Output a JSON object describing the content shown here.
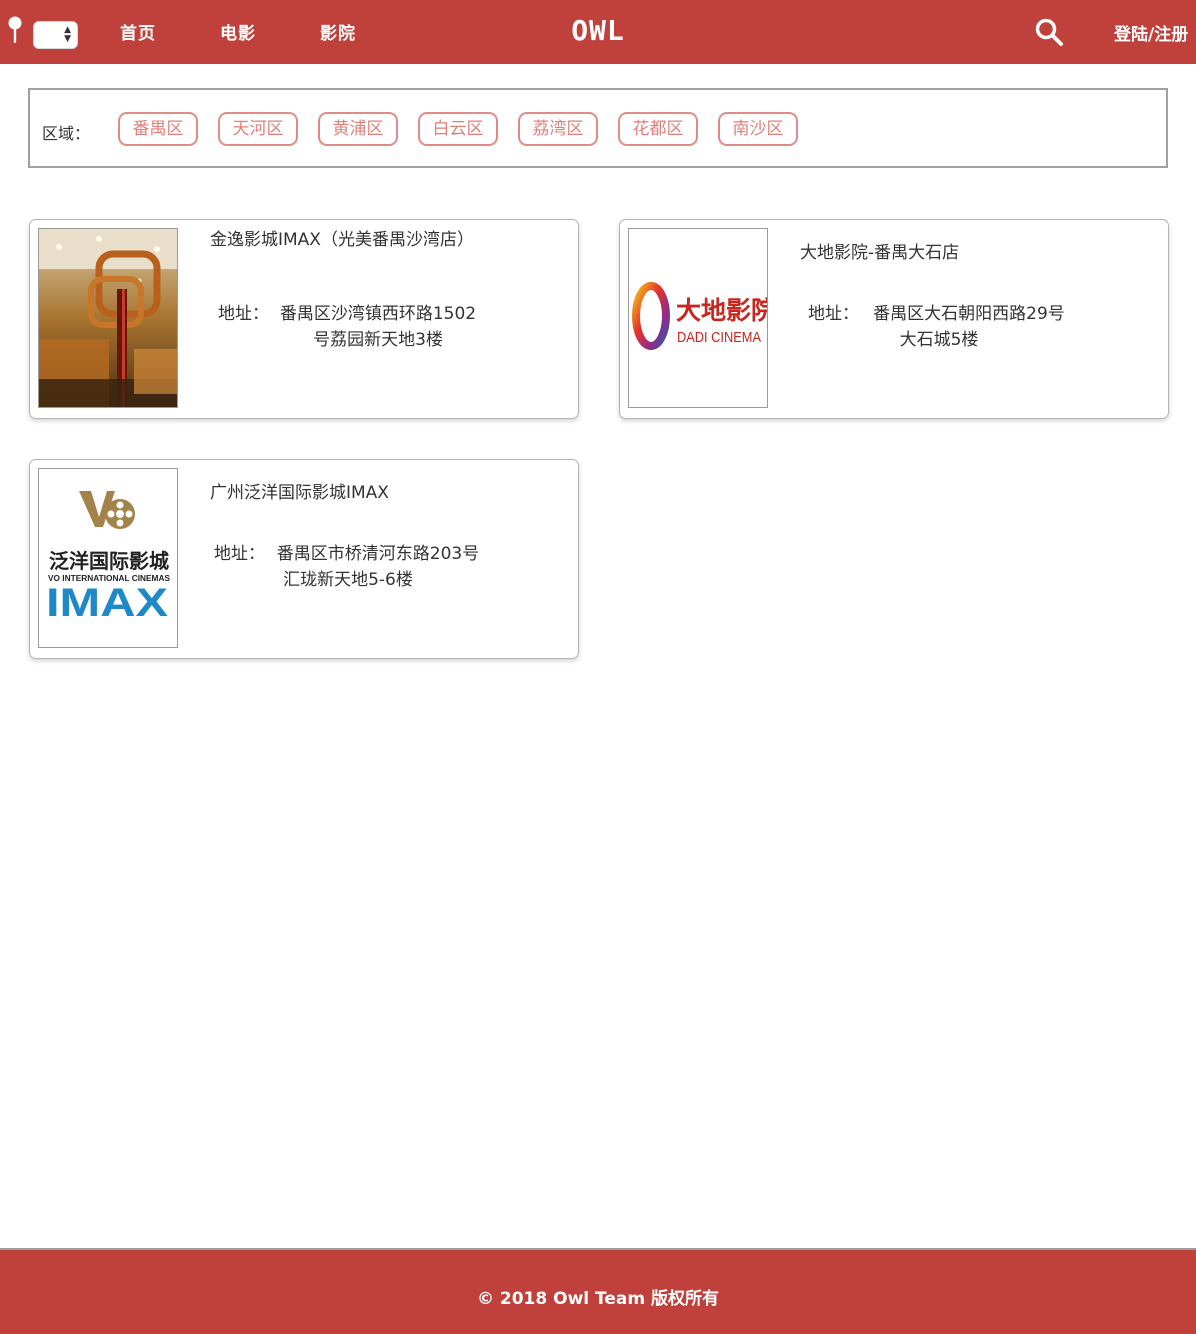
{
  "header": {
    "location_icon": "map-pin-icon",
    "city_select_value": "",
    "nav": [
      {
        "label": "首页"
      },
      {
        "label": "电影"
      },
      {
        "label": "影院"
      }
    ],
    "logo": "OWL",
    "search_icon": "search-icon",
    "login_label": "登陆/注册"
  },
  "filter": {
    "label": "区域：",
    "districts": [
      "番禺区",
      "天河区",
      "黄浦区",
      "白云区",
      "荔湾区",
      "花都区",
      "南沙区"
    ]
  },
  "cinemas": [
    {
      "name": "金逸影城IMAX（光美番禺沙湾店）",
      "address_label": "地址：",
      "address_line1": "番禺区沙湾镇西环路1502",
      "address_line2": "号荔园新天地3楼",
      "image": "cinema-lobby-photo"
    },
    {
      "name": "大地影院-番禺大石店",
      "address_label": "地址：",
      "address_line1": "番禺区大石朝阳西路29号",
      "address_line2": "大石城5楼",
      "image": "dadi-cinema-logo",
      "logo_text_cn": "大地影院",
      "logo_text_en": "DADI CINEMA"
    },
    {
      "name": "广州泛洋国际影城IMAX",
      "address_label": "地址：",
      "address_line1": "番禺区市桥清河东路203号",
      "address_line2": "汇珑新天地5-6楼",
      "image": "vo-imax-logo",
      "logo_text_cn": "泛洋国际影城",
      "logo_text_en": "VO INTERNATIONAL CINEMAS",
      "logo_text_imax": "IMAX"
    }
  ],
  "footer": {
    "text": "© 2018 Owl Team 版权所有"
  },
  "colors": {
    "brand": "#c0403b",
    "district_border": "#e08b87",
    "card_border": "#b5b5b5"
  }
}
